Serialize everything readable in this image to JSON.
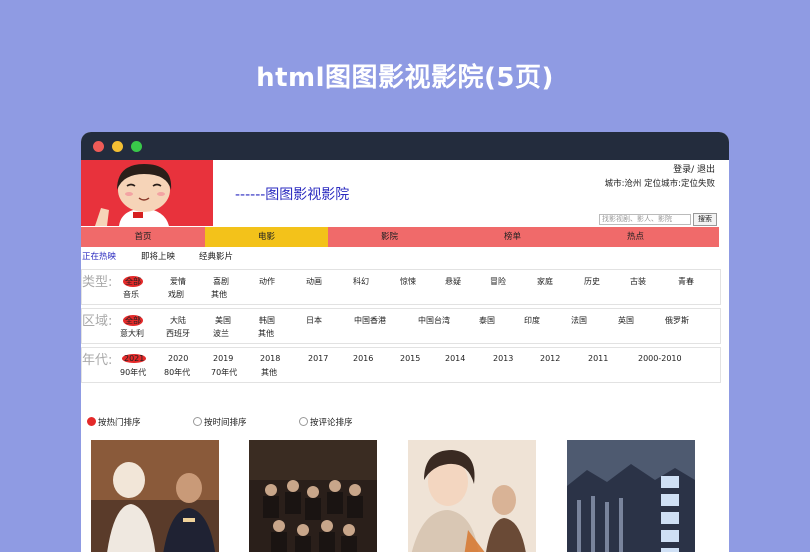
{
  "page_title": "html图图影视影院(5页)",
  "header": {
    "site_name": "------图图影视影院",
    "login": "登录",
    "logout": "/ 退出",
    "city": "城市:沧州 定位城市:定位失败",
    "search_placeholder": "找影视剧、影人、影院",
    "search_button": "搜索"
  },
  "nav": [
    "首页",
    "电影",
    "影院",
    "榜单",
    "热点"
  ],
  "subtabs": [
    "正在热映",
    "即将上映",
    "经典影片"
  ],
  "filters": {
    "type": {
      "label": "类型:",
      "row1": [
        "全部",
        "爱情",
        "喜剧",
        "动作",
        "动画",
        "科幻",
        "惊悚",
        "悬疑",
        "冒险",
        "家庭",
        "历史",
        "古装",
        "青春"
      ],
      "row2": [
        "音乐",
        "戏剧",
        "其他"
      ]
    },
    "region": {
      "label": "区域:",
      "row1": [
        "全部",
        "大陆",
        "美国",
        "韩国",
        "日本",
        "中国香港",
        "中国台湾",
        "泰国",
        "印度",
        "法国",
        "英国",
        "俄罗斯"
      ],
      "row2": [
        "意大利",
        "西班牙",
        "波兰",
        "其他"
      ]
    },
    "year": {
      "label": "年代:",
      "row1": [
        "2021",
        "2020",
        "2019",
        "2018",
        "2017",
        "2016",
        "2015",
        "2014",
        "2013",
        "2012",
        "2011",
        "2000-2010"
      ],
      "row2": [
        "90年代",
        "80年代",
        "70年代",
        "其他"
      ]
    }
  },
  "sort": [
    "按热门排序",
    "按时间排序",
    "按评论排序"
  ],
  "colors": {
    "background": "#8f9be3",
    "nav": "#f06a6a",
    "nav_active": "#f3c21a",
    "selected": "#e42a2a",
    "link": "#2b2bc0"
  }
}
